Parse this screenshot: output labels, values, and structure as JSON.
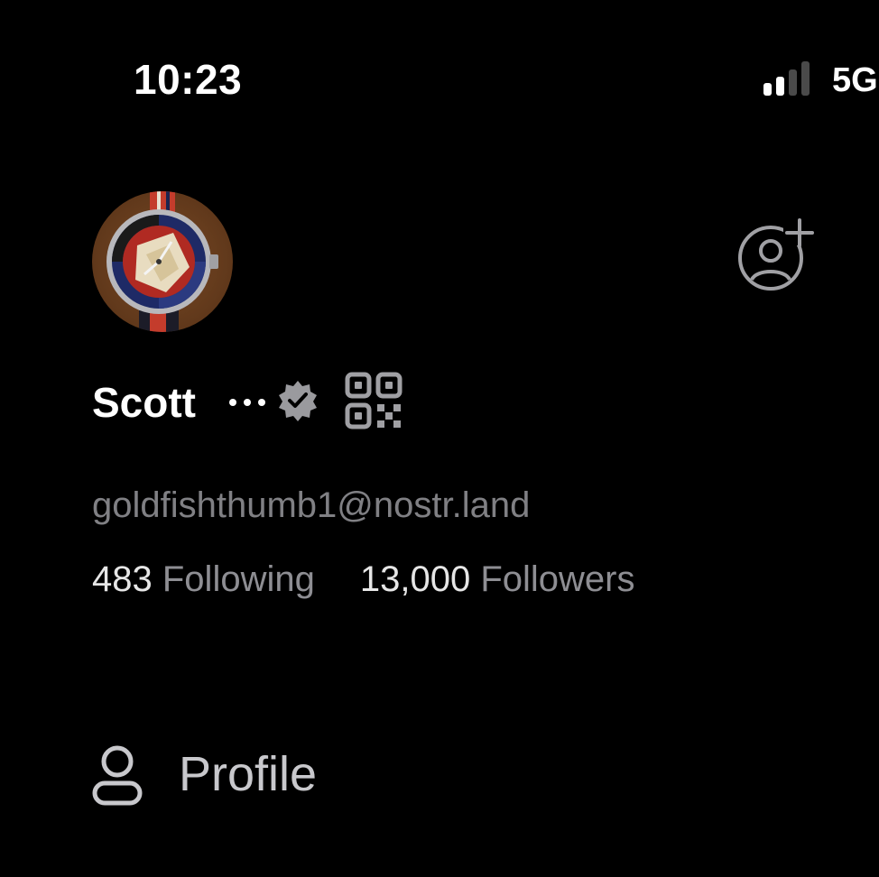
{
  "status_bar": {
    "time": "10:23",
    "network": "5G",
    "signal_bars_active": 2,
    "signal_bars_total": 4
  },
  "profile": {
    "avatar_icon": "watch-avatar",
    "name": "Scott",
    "verified_icon": "verified-badge-icon",
    "nip05": "goldfishthumb1@nostr.land",
    "following_count": "483",
    "following_label": "Following",
    "followers_count": "13,000",
    "followers_label": "Followers"
  },
  "actions": {
    "add_user_icon": "add-user-icon",
    "more_icon": "ellipsis-icon",
    "qr_icon": "qr-code-icon"
  },
  "menu": {
    "items": [
      {
        "icon": "person-icon",
        "label": "Profile"
      }
    ]
  },
  "colors": {
    "background": "#000000",
    "primary_text": "#ffffff",
    "secondary_text": "#8e8e93",
    "icon_gray": "#a0a0a4"
  }
}
